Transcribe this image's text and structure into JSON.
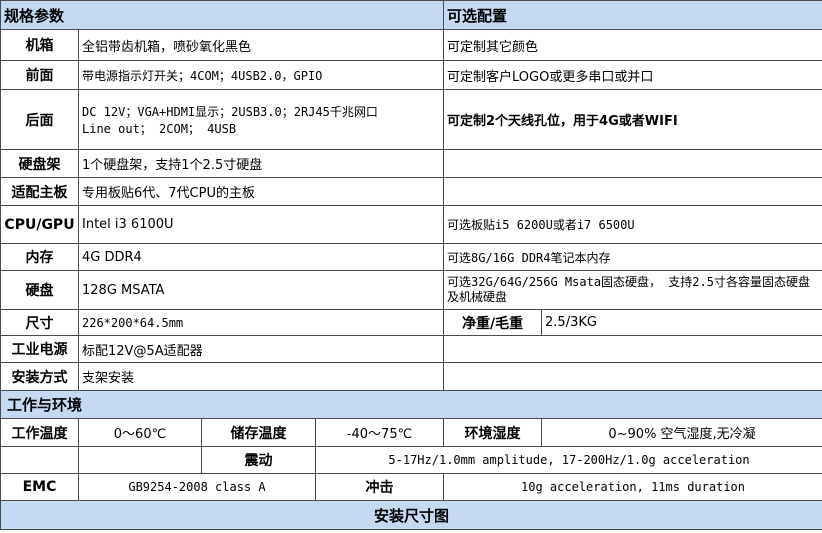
{
  "header": {
    "spec_title": "规格参数",
    "optional_title": "可选配置"
  },
  "rows": {
    "chassis": {
      "label": "机箱",
      "value": "全铝带齿机箱，喷砂氧化黑色",
      "option": "可定制其它颜色"
    },
    "front": {
      "label": "前面",
      "value": "带电源指示灯开关；4COM；4USB2.0，GPIO",
      "option": "可定制客户LOGO或更多串口或并口"
    },
    "rear": {
      "label": "后面",
      "value_line1": "DC 12V；VGA+HDMI显示；2USB3.0；2RJ45千兆网口",
      "value_line2": "Line out；  2COM；  4USB",
      "option": "可定制2个天线孔位，用于4G或者WIFI"
    },
    "hdd_bay": {
      "label": "硬盘架",
      "value": "1个硬盘架，支持1个2.5寸硬盘",
      "option": ""
    },
    "board": {
      "label": "适配主板",
      "value": "专用板贴6代、7代CPU的主板",
      "option": ""
    },
    "cpu": {
      "label": "CPU/GPU",
      "value": "Intel i3 6100U",
      "option": "可选板贴i5 6200U或者i7 6500U"
    },
    "memory": {
      "label": "内存",
      "value": "4G DDR4",
      "option": "可选8G/16G DDR4笔记本内存"
    },
    "storage": {
      "label": "硬盘",
      "value": "128G MSATA",
      "option": "可选32G/64G/256G Msata固态硬盘， 支持2.5寸各容量固态硬盘及机械硬盘"
    },
    "size": {
      "label": "尺寸",
      "value": "226*200*64.5mm",
      "weight_label": "净重/毛重",
      "weight_value": "2.5/3KG"
    },
    "power": {
      "label": "工业电源",
      "value": "标配12V@5A适配器",
      "option": ""
    },
    "mount": {
      "label": "安装方式",
      "value": "支架安装",
      "option": ""
    }
  },
  "environment": {
    "title": "工作与环境",
    "work_temp_label": "工作温度",
    "work_temp": "0～60℃",
    "storage_temp_label": "储存温度",
    "storage_temp": "-40～75℃",
    "humidity_label": "环境湿度",
    "humidity": "0~90% 空气湿度,无冷凝",
    "vibration_label": "震动",
    "vibration": "5-17Hz/1.0mm amplitude, 17-200Hz/1.0g acceleration",
    "emc_label": "EMC",
    "emc": "GB9254-2008 class A",
    "shock_label": "冲击",
    "shock": "10g acceleration, 11ms duration"
  },
  "footer": {
    "title": "安装尺寸图"
  }
}
